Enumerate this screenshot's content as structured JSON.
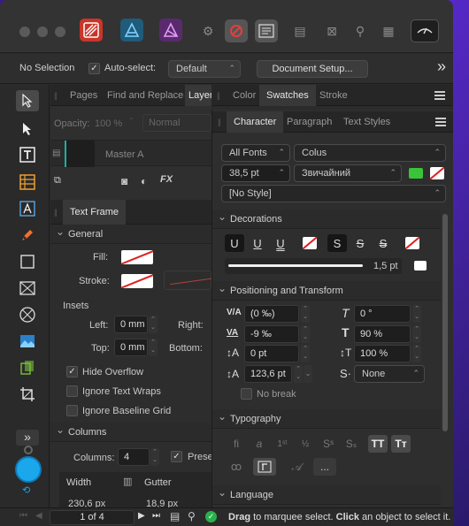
{
  "context_bar": {
    "selection_label": "No Selection",
    "autoselect_label": "Auto-select:",
    "autoselect_value": "Default",
    "document_setup_label": "Document Setup...",
    "more_glyph": "»"
  },
  "left_panel": {
    "tabs": [
      "Pages",
      "Find and Replace",
      "Layer"
    ],
    "opacity_label": "Opacity:",
    "opacity_value": "100 %",
    "blend_value": "Normal",
    "master_label": "Master A",
    "text_frame_tab": "Text Frame",
    "general": {
      "header": "General",
      "fill_label": "Fill:",
      "stroke_label": "Stroke:",
      "insets_label": "Insets",
      "left_label": "Left:",
      "left_value": "0 mm",
      "right_label": "Right:",
      "top_label": "Top:",
      "top_value": "0 mm",
      "bottom_label": "Bottom:",
      "hide_overflow": "Hide Overflow",
      "ignore_text_wraps": "Ignore Text Wraps",
      "ignore_baseline_grid": "Ignore Baseline Grid"
    },
    "columns": {
      "header": "Columns",
      "columns_label": "Columns:",
      "columns_value": "4",
      "preserve_label": "Prese",
      "width_label": "Width",
      "gutter_label": "Gutter",
      "width_value": "230,6 px",
      "gutter_value": "18,9 px"
    }
  },
  "swatches_tabs": [
    "Color",
    "Swatches",
    "Stroke"
  ],
  "character_panel": {
    "tabs": [
      "Character",
      "Paragraph",
      "Text Styles"
    ],
    "font_collection": "All Fonts",
    "font_family": "Colus",
    "font_size": "38,5 pt",
    "font_style": "Звичайний",
    "text_style": "[No Style]",
    "colors": {
      "fill": "#3ac43a"
    },
    "decorations": {
      "header": "Decorations",
      "underline_glyph": "U",
      "strike_glyph": "S",
      "stroke_value": "1,5 pt"
    },
    "positioning": {
      "header": "Positioning and Transform",
      "kerning_value": "(0 ‰)",
      "tracking_value": "-9 ‰",
      "baseline_value": "0 pt",
      "leading_value": "123,6 pt",
      "shear_value": "0 °",
      "vertical_scale_value": "90 %",
      "horizontal_scale_value": "100 %",
      "position_value": "None",
      "no_break_label": "No break"
    },
    "typography_header": "Typography",
    "language_header": "Language"
  },
  "status_bar": {
    "page_indicator": "1 of 4",
    "hint_bold_1": "Drag",
    "hint_text_1": " to marquee select. ",
    "hint_bold_2": "Click",
    "hint_text_2": " an object to select it."
  }
}
